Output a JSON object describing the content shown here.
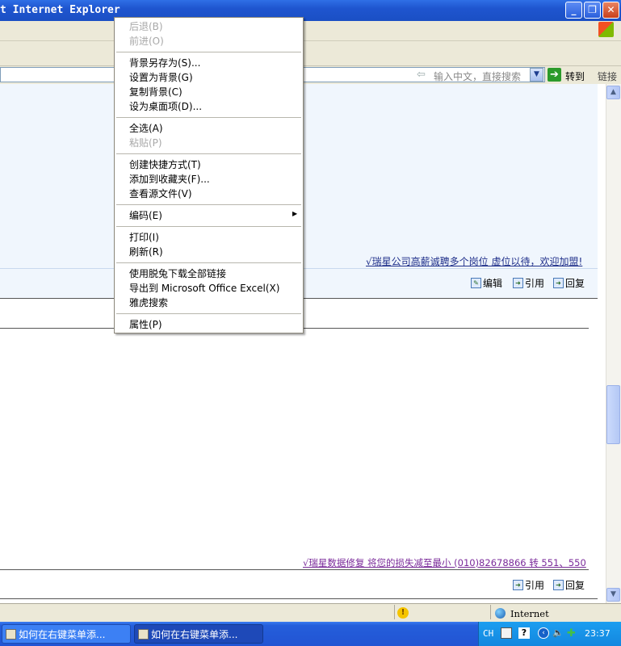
{
  "window": {
    "title": "t Internet Explorer"
  },
  "addressbar": {
    "search_placeholder": "输入中文，直接搜索",
    "go_label": "转到",
    "links_label": "链接"
  },
  "content": {
    "ad1": "√瑞星公司高薪诚聘多个岗位 虚位以待，欢迎加盟!",
    "ad2": "√瑞星数据修复 将您的损失减至最小 (010)82678866 转 551、550",
    "actions": {
      "edit": "编辑",
      "quote": "引用",
      "reply": "回复"
    }
  },
  "context_menu": {
    "items": [
      {
        "label": "后退(B)",
        "disabled": true
      },
      {
        "label": "前进(O)",
        "disabled": true
      },
      {
        "label": "背景另存为(S)...",
        "disabled": false
      },
      {
        "label": "设置为背景(G)",
        "disabled": false
      },
      {
        "label": "复制背景(C)",
        "disabled": false
      },
      {
        "label": "设为桌面项(D)...",
        "disabled": false
      },
      {
        "label": "全选(A)",
        "disabled": false
      },
      {
        "label": "粘贴(P)",
        "disabled": true
      },
      {
        "label": "创建快捷方式(T)",
        "disabled": false
      },
      {
        "label": "添加到收藏夹(F)...",
        "disabled": false
      },
      {
        "label": "查看源文件(V)",
        "disabled": false
      },
      {
        "label": "编码(E)",
        "disabled": false,
        "submenu": true
      },
      {
        "label": "打印(I)",
        "disabled": false
      },
      {
        "label": "刷新(R)",
        "disabled": false
      },
      {
        "label": "使用脱兔下载全部链接",
        "disabled": false
      },
      {
        "label": "导出到 Microsoft Office Excel(X)",
        "disabled": false
      },
      {
        "label": "雅虎搜索",
        "disabled": false
      },
      {
        "label": "属性(P)",
        "disabled": false
      }
    ]
  },
  "statusbar": {
    "zone": "Internet"
  },
  "taskbar": {
    "tasks": [
      {
        "label": "如何在右键菜单添..."
      },
      {
        "label": "如何在右键菜单添..."
      }
    ],
    "ime": "CH",
    "clock": "23:37"
  },
  "colors": {
    "titlebar": "#1f55cf",
    "content_bg": "#f0f6fd",
    "ad1": "#1f2f8a",
    "ad2": "#7a2a9a",
    "taskbar": "#245edb"
  }
}
